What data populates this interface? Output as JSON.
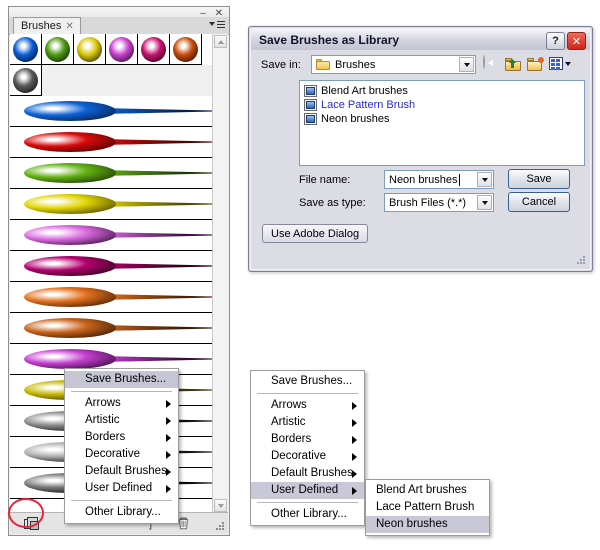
{
  "brushes_panel": {
    "tab_label": "Brushes",
    "tab_close": "✕",
    "minimize": "–",
    "close": "✕",
    "thumbnails": [
      {
        "name": "blue-brush-thumb",
        "color": "#0b5fd6",
        "highlight": "#ffffff"
      },
      {
        "name": "green-brush-thumb",
        "color": "#4f9a14",
        "highlight": "#ffffff"
      },
      {
        "name": "yellow-brush-thumb",
        "color": "#d8c706",
        "highlight": "#ffffff"
      },
      {
        "name": "magenta-brush-thumb",
        "color": "#cb3fd0",
        "highlight": "#ffffff"
      },
      {
        "name": "pink-brush-thumb",
        "color": "#c8126f",
        "highlight": "#ffffff"
      },
      {
        "name": "orange-brush-thumb",
        "color": "#c94a0a",
        "highlight": "#ffffff"
      },
      {
        "name": "gray-brush-thumb",
        "color": "#5a5a5a",
        "highlight": "#ffffff"
      }
    ],
    "strokes": [
      {
        "name": "blue-stroke",
        "color": "#0d62d6",
        "dark": "#06204f"
      },
      {
        "name": "red-stroke",
        "color": "#d80b0b",
        "dark": "#4c0202"
      },
      {
        "name": "green-stroke",
        "color": "#63b214",
        "dark": "#1d3a05"
      },
      {
        "name": "yellow-stroke",
        "color": "#e2d500",
        "dark": "#4f4a00"
      },
      {
        "name": "violet-stroke",
        "color": "#dc6ce0",
        "dark": "#3d0f44"
      },
      {
        "name": "magenta-stroke",
        "color": "#b4006e",
        "dark": "#2e0019"
      },
      {
        "name": "orange-stroke",
        "color": "#e2711e",
        "dark": "#4c2103"
      },
      {
        "name": "copper-stroke",
        "color": "#c9641c",
        "dark": "#3a1a03"
      },
      {
        "name": "purple-stroke",
        "color": "#c43fd0",
        "dark": "#3a0d3f"
      },
      {
        "name": "olive-stroke",
        "color": "#c5b700",
        "dark": "#3b3600"
      },
      {
        "name": "gray-stroke",
        "color": "#8c8c8c",
        "dark": "#111111"
      },
      {
        "name": "silver-stroke",
        "color": "#b0b0b0",
        "dark": "#151515"
      },
      {
        "name": "dark-stroke",
        "color": "#7a7a7a",
        "dark": "#0a0a0a"
      }
    ],
    "footer": {
      "new_brush_icon": "new-brush-icon",
      "delete_icon": "trash-icon",
      "brace": "]"
    }
  },
  "save_dialog": {
    "title": "Save Brushes as Library",
    "help_btn": "?",
    "close_btn": "✕",
    "save_in_label": "Save in:",
    "save_in_value": "Brushes",
    "toolbar": {
      "back": "back-arrow-icon",
      "up": "up-one-level-icon",
      "new_folder": "new-folder-icon",
      "views": "views-icon"
    },
    "files": [
      {
        "label": "Blend Art brushes",
        "selected": false
      },
      {
        "label": "Lace Pattern Brush",
        "selected": true
      },
      {
        "label": "Neon brushes",
        "selected": false
      }
    ],
    "file_name_label": "File name:",
    "file_name_value": "Neon brushes",
    "save_as_type_label": "Save as type:",
    "save_as_type_value": "Brush Files (*.*)",
    "save_button": "Save",
    "cancel_button": "Cancel",
    "use_adobe_dialog": "Use Adobe Dialog"
  },
  "context_menu_left": {
    "items": [
      {
        "label": "Save Brushes...",
        "submenu": false,
        "highlighted": true
      },
      {
        "label": "Arrows",
        "submenu": true,
        "highlighted": false
      },
      {
        "label": "Artistic",
        "submenu": true,
        "highlighted": false
      },
      {
        "label": "Borders",
        "submenu": true,
        "highlighted": false
      },
      {
        "label": "Decorative",
        "submenu": true,
        "highlighted": false
      },
      {
        "label": "Default Brushes",
        "submenu": true,
        "highlighted": false
      },
      {
        "label": "User Defined",
        "submenu": true,
        "highlighted": false
      },
      {
        "label": "Other Library...",
        "submenu": false,
        "highlighted": false
      }
    ]
  },
  "context_menu_right": {
    "items": [
      {
        "label": "Save Brushes...",
        "submenu": false,
        "highlighted": false
      },
      {
        "label": "Arrows",
        "submenu": true,
        "highlighted": false
      },
      {
        "label": "Artistic",
        "submenu": true,
        "highlighted": false
      },
      {
        "label": "Borders",
        "submenu": true,
        "highlighted": false
      },
      {
        "label": "Decorative",
        "submenu": true,
        "highlighted": false
      },
      {
        "label": "Default Brushes",
        "submenu": true,
        "highlighted": false
      },
      {
        "label": "User Defined",
        "submenu": true,
        "highlighted": true
      },
      {
        "label": "Other Library...",
        "submenu": false,
        "highlighted": false
      }
    ],
    "submenu": {
      "items": [
        {
          "label": "Blend Art brushes",
          "highlighted": false
        },
        {
          "label": "Lace Pattern Brush",
          "highlighted": false
        },
        {
          "label": "Neon brushes",
          "highlighted": true
        }
      ]
    }
  },
  "annotation": {
    "highlight_color": "#e8253a",
    "target": "panel-menu-flyout-button"
  }
}
